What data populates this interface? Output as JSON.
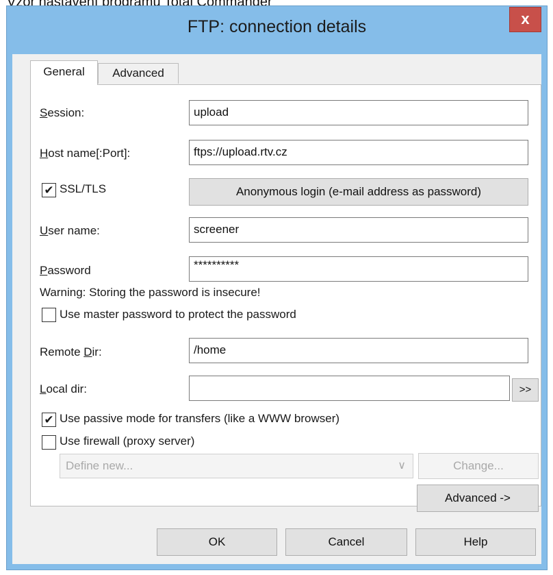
{
  "caption": "Vzor nastavení programu Total Commander",
  "window": {
    "title": "FTP: connection details",
    "close_glyph": "x"
  },
  "tabs": [
    {
      "label": "General",
      "active": true
    },
    {
      "label": "Advanced",
      "active": false
    }
  ],
  "form": {
    "session": {
      "label_u": "S",
      "label_rest": "ession:",
      "value": "upload"
    },
    "host": {
      "label_u": "H",
      "label_rest": "ost name[:Port]:",
      "value": "ftps://upload.rtv.cz"
    },
    "ssl": {
      "label": "SSL/TLS",
      "checked": true,
      "mark": "✔"
    },
    "anonymous_button": "Anonymous login (e-mail address as password)",
    "user": {
      "label_u": "U",
      "label_rest": "ser name:",
      "value": "screener"
    },
    "password": {
      "label_u": "P",
      "label_rest": "assword",
      "value": "**********"
    },
    "warning": "Warning: Storing the password is insecure!",
    "master_password": {
      "label": "Use master password to protect the password",
      "checked": false
    },
    "remote_dir": {
      "label_pre": "Remote ",
      "label_u": "D",
      "label_rest": "ir:",
      "value": "/home"
    },
    "local_dir": {
      "label_u": "L",
      "label_rest": "ocal dir:",
      "value": "",
      "browse": ">>"
    },
    "passive": {
      "label": "Use passive mode for transfers (like a WWW browser)",
      "checked": true,
      "mark": "✔"
    },
    "firewall": {
      "label": "Use firewall (proxy server)",
      "checked": false
    },
    "proxy_select": {
      "value": "Define new...",
      "arrow": "∨"
    },
    "change_button": "Change...",
    "advanced_button": "Advanced ->"
  },
  "buttons": {
    "ok": "OK",
    "cancel": "Cancel",
    "help": "Help"
  },
  "colors": {
    "frame": "#85bde9",
    "close": "#c8504a",
    "client": "#f0f0f0"
  }
}
